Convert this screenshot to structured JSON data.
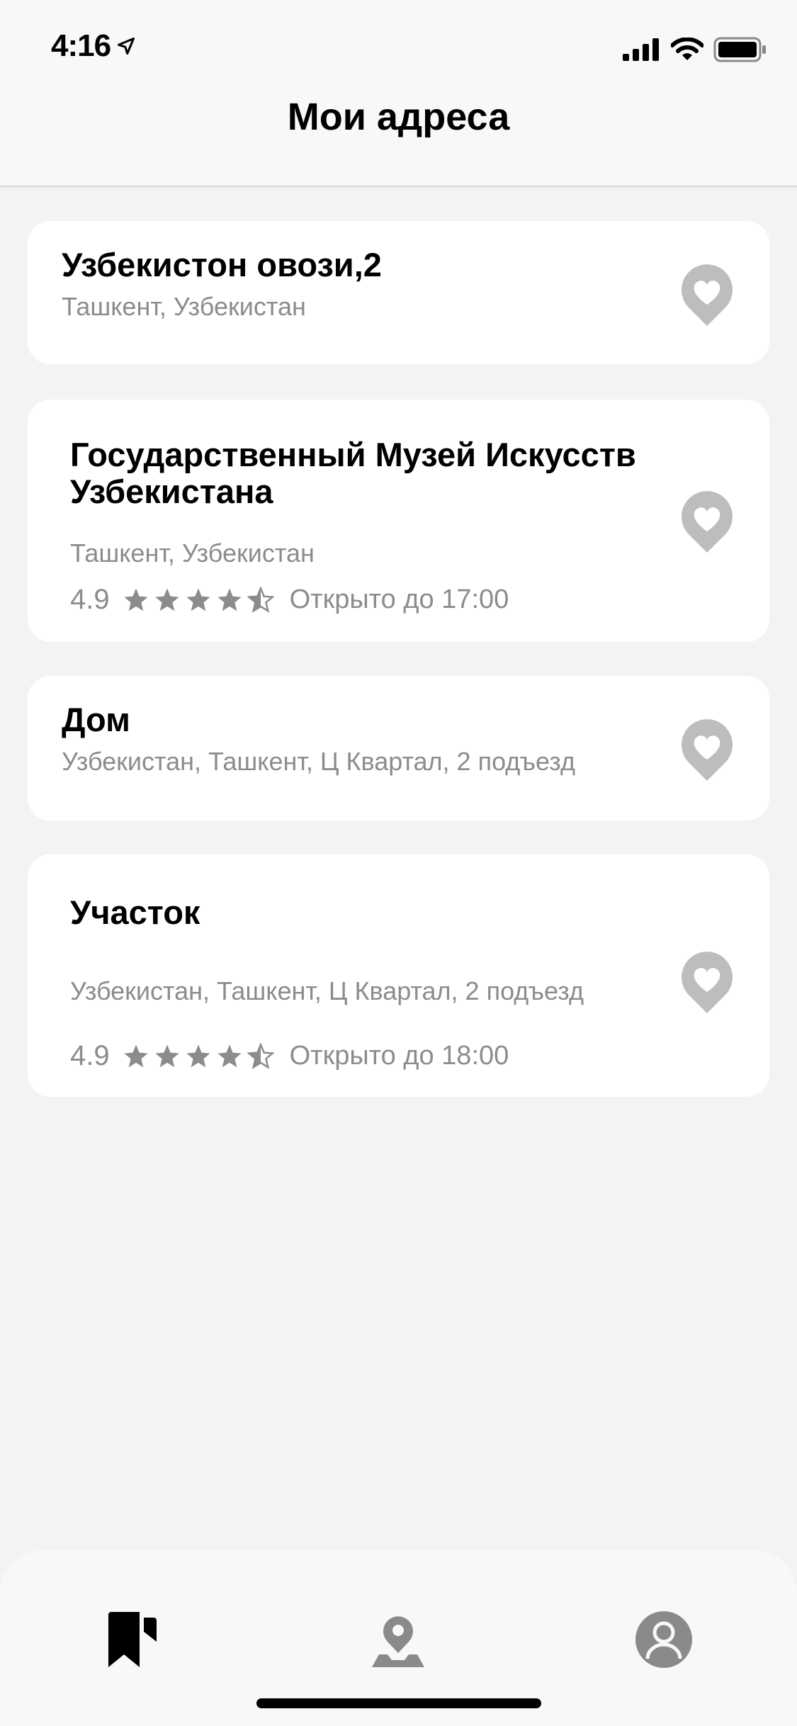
{
  "status_bar": {
    "time": "4:16"
  },
  "header": {
    "title": "Мои адреса"
  },
  "addresses": [
    {
      "title": "Узбекистон овози,2",
      "subtitle": "Ташкент, Узбекистан"
    },
    {
      "title": "Государственный Музей Искусств Узбекистана",
      "subtitle": "Ташкент, Узбекистан",
      "rating": "4.9",
      "stars": 4.5,
      "hours": "Открыто до 17:00"
    },
    {
      "title": "Дом",
      "subtitle": "Узбекистан, Ташкент, Ц Квартал, 2 подъезд"
    },
    {
      "title": "Участок",
      "subtitle": "Узбекистан, Ташкент, Ц Квартал, 2 подъезд",
      "rating": "4.9",
      "stars": 4.5,
      "hours": "Открыто до 18:00"
    }
  ],
  "tab_bar": {
    "items": [
      {
        "icon": "bookmark-icon",
        "active": true
      },
      {
        "icon": "map-pin-icon",
        "active": false
      },
      {
        "icon": "profile-icon",
        "active": false
      }
    ]
  },
  "colors": {
    "background": "#f3f3f3",
    "card": "#ffffff",
    "secondary_text": "#8c8c8c",
    "icon_gray": "#bdbdbd"
  }
}
